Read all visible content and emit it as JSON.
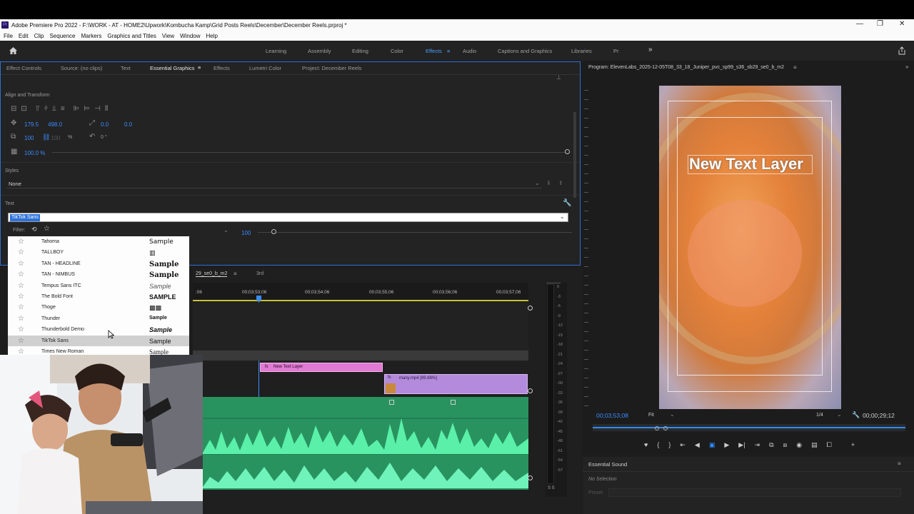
{
  "title_bar": {
    "app_icon": "Pr",
    "title": "Adobe Premiere Pro 2022 - F:\\WORK - AT - HOME2\\Upwork\\Kombucha Kamp\\Grid Posts Reels\\December\\December Reels.prproj *"
  },
  "menu": [
    "File",
    "Edit",
    "Clip",
    "Sequence",
    "Markers",
    "Graphics and Titles",
    "View",
    "Window",
    "Help"
  ],
  "workspaces": [
    "Learning",
    "Assembly",
    "Editing",
    "Color",
    "Effects",
    "Audio",
    "Captions and Graphics",
    "Libraries",
    "Pr"
  ],
  "active_workspace": "Effects",
  "panel_tabs": [
    "Effect Controls",
    "Source: (no clips)",
    "Text",
    "Essential Graphics",
    "Effects",
    "Lumetri Color",
    "Project: December Reels"
  ],
  "active_panel_tab": "Essential Graphics",
  "align_transform": {
    "heading": "Align and Transform",
    "pos_x": "179.5",
    "pos_y": "498.0",
    "rotation_a": "0.0",
    "rotation_b": "0.0",
    "scale": "100",
    "scale_b": "100",
    "scale_unit": "%",
    "rotate": "0 °",
    "opacity": "100.0 %"
  },
  "styles": {
    "heading": "Styles",
    "value": "None"
  },
  "text_section": {
    "heading": "Text",
    "font_value": "TikTok Sans",
    "filter_label": "Filter:",
    "size_value": "100"
  },
  "font_list": [
    {
      "name": "Tahoma",
      "sample": "Sample"
    },
    {
      "name": "TALLBOY",
      "sample": ""
    },
    {
      "name": "TAN - HEADLINE",
      "sample": "Sample"
    },
    {
      "name": "TAN - NIMBUS",
      "sample": "Sample"
    },
    {
      "name": "Tempus Sans ITC",
      "sample": "Sample"
    },
    {
      "name": "The Bold Font",
      "sample": "SAMPLE"
    },
    {
      "name": "Thoge",
      "sample": ""
    },
    {
      "name": "Thunder",
      "sample": "Sample"
    },
    {
      "name": "Thunderbold Demo",
      "sample": "Sample"
    },
    {
      "name": "TikTok Sans",
      "sample": "Sample"
    },
    {
      "name": "Times New Roman",
      "sample": "Sample"
    }
  ],
  "timeline": {
    "tab1": "29_se0_b_m2",
    "tab2": "3rd",
    "timecodes": [
      "00;03;53;06",
      "00;03;54;06",
      "00;03;55;06",
      "00;03;56;06",
      "00;03;57;06"
    ],
    "left_timecode": ":06",
    "clip_text": "New Text Layer",
    "clip_video": "many.mp4 [89.88%]",
    "meter_scale": [
      "0",
      "-3",
      "-6",
      "-9",
      "-12",
      "-15",
      "-18",
      "-21",
      "-24",
      "-27",
      "-30",
      "-33",
      "-36",
      "-39",
      "-42",
      "-45",
      "-48",
      "-51",
      "-54",
      "-57"
    ],
    "meter_footer": "S  S"
  },
  "program": {
    "title": "Program: ElevenLabs_2025-12-05T08_33_18_Juniper_pvc_sp99_s36_sb29_se0_b_m2",
    "overlay_text": "New Text Layer",
    "current_time": "00;03;53;08",
    "fit": "Fit",
    "resolution": "1/4",
    "duration": "00;00;29;12"
  },
  "essential_sound": {
    "title": "Essential Sound",
    "no_selection": "No Selection",
    "preset": "Preset"
  },
  "colors": {
    "accent_blue": "#2d8cff",
    "clip_pink": "#e07ad4",
    "clip_purple": "#b48bdc",
    "audio_green": "#2fbf7a"
  }
}
